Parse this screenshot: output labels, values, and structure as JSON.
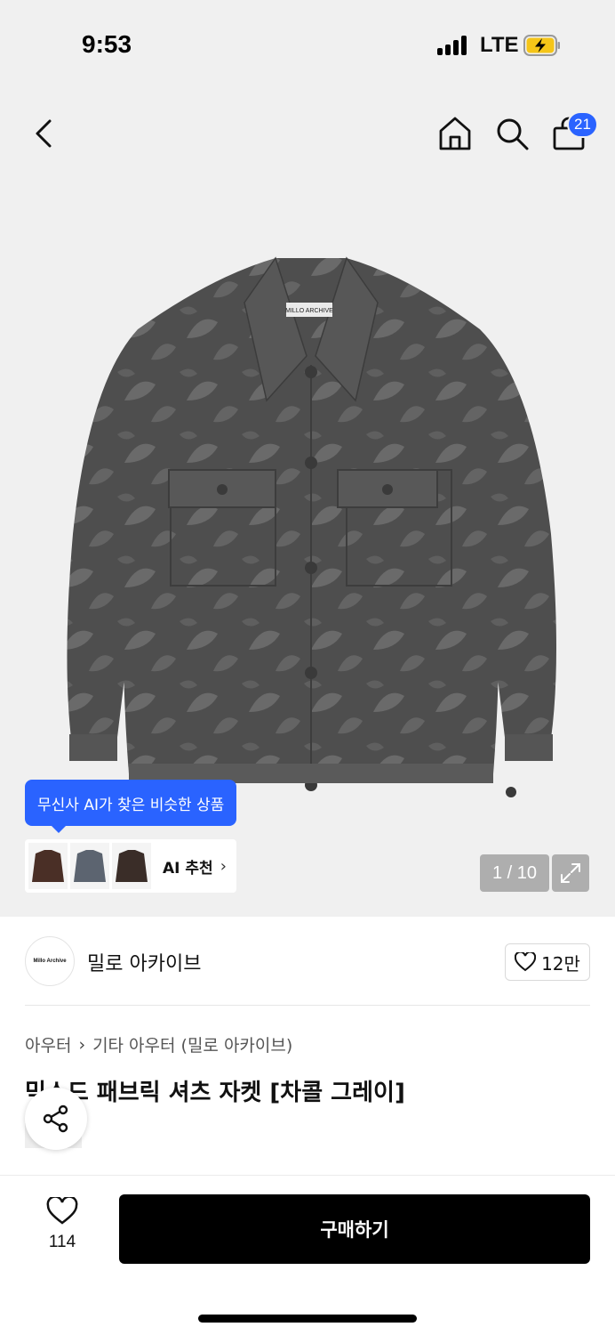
{
  "status_bar": {
    "time": "9:53",
    "network": "LTE"
  },
  "nav": {
    "cart_count": "21"
  },
  "product_image": {
    "pager": "1 / 10",
    "label_text": "MILLO ARCHIVE"
  },
  "ai": {
    "tooltip": "무신사 AI가 찾은 비슷한 상품",
    "card_label": "AI 추천"
  },
  "brand": {
    "logo_text": "Millo Archive",
    "name": "밀로 아카이브",
    "likes": "12만"
  },
  "breadcrumb": [
    "아우터",
    "기타 아우터 (밀로 아카이브)"
  ],
  "product": {
    "title": "믹스드 패브릭 셔츠 자켓 [차콜 그레이]"
  },
  "bottom": {
    "favorite_count": "114",
    "buy_label": "구매하기"
  },
  "colors": {
    "accent": "#2a63ff",
    "buy_button": "#000000",
    "hero_bg": "#f0f0f0"
  }
}
